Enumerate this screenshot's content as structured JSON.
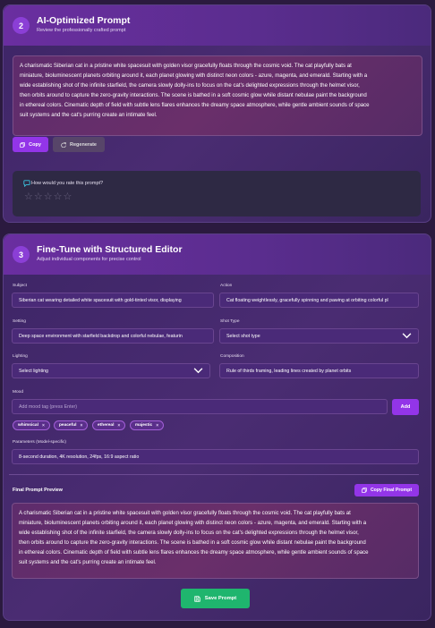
{
  "section1": {
    "step": "2",
    "title": "AI-Optimized Prompt",
    "subtitle": "Review the professionally crafted prompt",
    "prompt_lines": [
      "A charismatic Siberian cat in a pristine white spacesuit with golden visor gracefully floats through the cosmic void. The cat playfully bats at",
      "miniature, bioluminescent planets orbiting around it, each planet glowing with distinct neon colors - azure, magenta, and emerald. Starting with a",
      "wide establishing shot of the infinite starfield, the camera slowly dolly-ins to focus on the cat's delighted expressions through the helmet visor,",
      "then orbits around to capture the zero-gravity interactions. The scene is bathed in a soft cosmic glow while distant nebulae paint the background",
      "in ethereal colors. Cinematic depth of field with subtle lens flares enhances the dreamy space atmosphere, while gentle ambient sounds of space",
      "suit systems and the cat's purring create an intimate feel."
    ],
    "copy_label": "Copy",
    "regenerate_label": "Regenerate",
    "rating_question": "How would you rate this prompt?",
    "stars": [
      "☆",
      "☆",
      "☆",
      "☆",
      "☆"
    ]
  },
  "section2": {
    "step": "3",
    "title": "Fine-Tune with Structured Editor",
    "subtitle": "Adjust individual components for precise control",
    "subject_label": "Subject",
    "subject_value": "Siberian cat wearing detailed white spacesuit with gold-tinted visor, displaying",
    "action_label": "Action",
    "action_value": "Cat floating weightlessly, gracefully spinning and pawing at orbiting colorful pl",
    "setting_label": "Setting",
    "setting_value": "Deep space environment with starfield backdrop and colorful nebulae, featurin",
    "shot_type_label": "Shot Type",
    "shot_type_value": "Select shot type",
    "lighting_label": "Lighting",
    "lighting_value": "Select lighting",
    "composition_label": "Composition",
    "composition_value": "Rule of thirds framing, leading lines created by planet orbits",
    "mood_label": "Mood",
    "mood_placeholder": "Add mood tag (press Enter)",
    "add_label": "Add",
    "mood_tags": [
      "whimsical",
      "peaceful",
      "ethereal",
      "majestic"
    ],
    "tag_remove": "×",
    "parameters_label": "Parameters (Model-specific)",
    "parameters_value": "8-second duration, 4K resolution, 24fps, 16:9 aspect ratio",
    "final_preview_label": "Final Prompt Preview",
    "copy_final_label": "Copy Final Prompt",
    "final_lines": [
      "A charismatic Siberian cat in a pristine white spacesuit with golden visor gracefully floats through the cosmic void. The cat playfully bats at",
      "miniature, bioluminescent planets orbiting around it, each planet glowing with distinct neon colors - azure, magenta, and emerald. Starting with a",
      "wide establishing shot of the infinite starfield, the camera slowly dolly-ins to focus on the cat's delighted expressions through the helmet visor,",
      "then orbits around to capture the zero-gravity interactions. The scene is bathed in a soft cosmic glow while distant nebulae paint the background",
      "in ethereal colors. Cinematic depth of field with subtle lens flares enhances the dreamy space atmosphere, while gentle ambient sounds of space",
      "suit systems and the cat's purring create an intimate feel."
    ],
    "save_label": "Save Prompt"
  },
  "icons": {
    "copy": "copy-icon",
    "regenerate": "refresh-icon",
    "chat": "chat-bubble-icon",
    "chevron": "chevron-down-icon",
    "save": "floppy-disk-icon"
  },
  "colors": {
    "accent": "#9335e8",
    "save": "#1fb56e",
    "step_badge": "#8b3fd6",
    "rating_icon": "#3bc4e0"
  }
}
